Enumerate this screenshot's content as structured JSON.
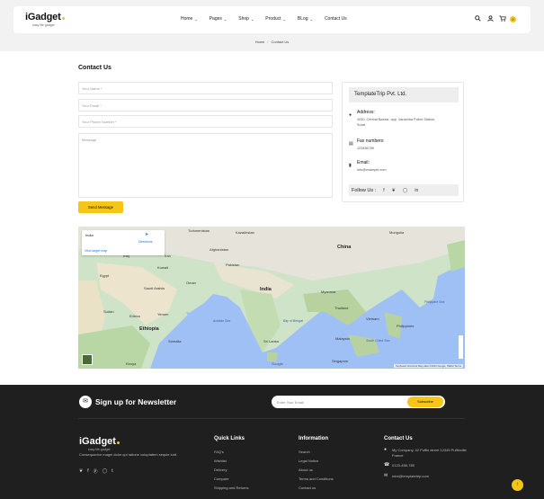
{
  "header": {
    "logo": "iGadget",
    "logo_tag": "easy life gadget",
    "nav": [
      {
        "label": "Home",
        "chev": "⌄"
      },
      {
        "label": "Pages",
        "chev": "⌄"
      },
      {
        "label": "Shop",
        "chev": "⌄"
      },
      {
        "label": "Product",
        "chev": "⌄"
      },
      {
        "label": "BLog",
        "chev": "⌄"
      },
      {
        "label": "Contact Us",
        "chev": ""
      }
    ],
    "cart_count": "0"
  },
  "breadcrumb": {
    "home": "Home",
    "sep": "/",
    "current": "Contact Us"
  },
  "contact": {
    "title": "Contact Us",
    "name_placeholder": "Your Name *",
    "email_placeholder": "Your Email *",
    "phone_placeholder": "Your Phone Number *",
    "message_placeholder": "Message",
    "send_label": "Send Message"
  },
  "info": {
    "company": "TemplateTrip Pvt. Ltd.",
    "address_label": "Address:",
    "address_text": "4030, Central Bazzar, opp. Varachha Police Station, Surat",
    "fax_label": "Fax numbers:",
    "fax_text": "123456789",
    "email_label": "Email:",
    "email_text": "info@example.com",
    "follow_label": "Follow Us :"
  },
  "map": {
    "card_title": "India",
    "card_link": "View larger map",
    "directions": "Directions",
    "labels": {
      "turkmenistan": "Turkmenistan",
      "kazakhstan": "Kazakhstan",
      "afghanistan": "Afghanistan",
      "china": "China",
      "iraq": "Iraq",
      "iran": "Iran",
      "pakistan": "Pakistan",
      "egypt": "Egypt",
      "kuwait": "Kuwait",
      "saudi_arabia": "Saudi Arabia",
      "oman": "Oman",
      "india": "India",
      "myanmar": "Myanmar",
      "sudan": "Sudan",
      "yemen": "Yemen",
      "thailand": "Thailand",
      "eritrea": "Eritrea",
      "ethiopia": "Ethiopia",
      "somalia": "Somalia",
      "sri_lanka": "Sri Lanka",
      "malaysia": "Malaysia",
      "kenya": "Kenya",
      "singapore": "Singapore",
      "philippines": "Philippines",
      "vietnam": "Vietnam",
      "bay": "Bay of Bengal",
      "arabian_sea": "Arabian Sea",
      "philippine_sea": "Philippine Sea",
      "south_china_sea": "South China Sea",
      "mongolia": "Mongolia"
    },
    "google": "Google",
    "attribution": "Keyboard shortcuts   Map data ©2023 Google, INEGI   Terms"
  },
  "newsletter": {
    "title": "Sign up for Newsletter",
    "placeholder": "Enter Your Email",
    "button": "Subscribe"
  },
  "footer": {
    "logo": "iGadget",
    "logo_tag": "easy life gadget",
    "desc": "Consequuntur magni dolor qui ratione voluptatem sequie iurit.",
    "quick_links_title": "Quick Links",
    "quick_links": [
      "FAQ's",
      "Wishlist",
      "Delivery",
      "Compare",
      "Shipping and Returns"
    ],
    "info_title": "Information",
    "info_links": [
      "Search",
      "Legal Notice",
      "About us",
      "Terms and Conditions",
      "Contact us"
    ],
    "contact_title": "Contact Us",
    "contact_address": "My Company, 42 Puffin street 12345 Puffinville France",
    "contact_phone": "0123-456-789",
    "contact_email": "mini@templatetrip.com"
  }
}
